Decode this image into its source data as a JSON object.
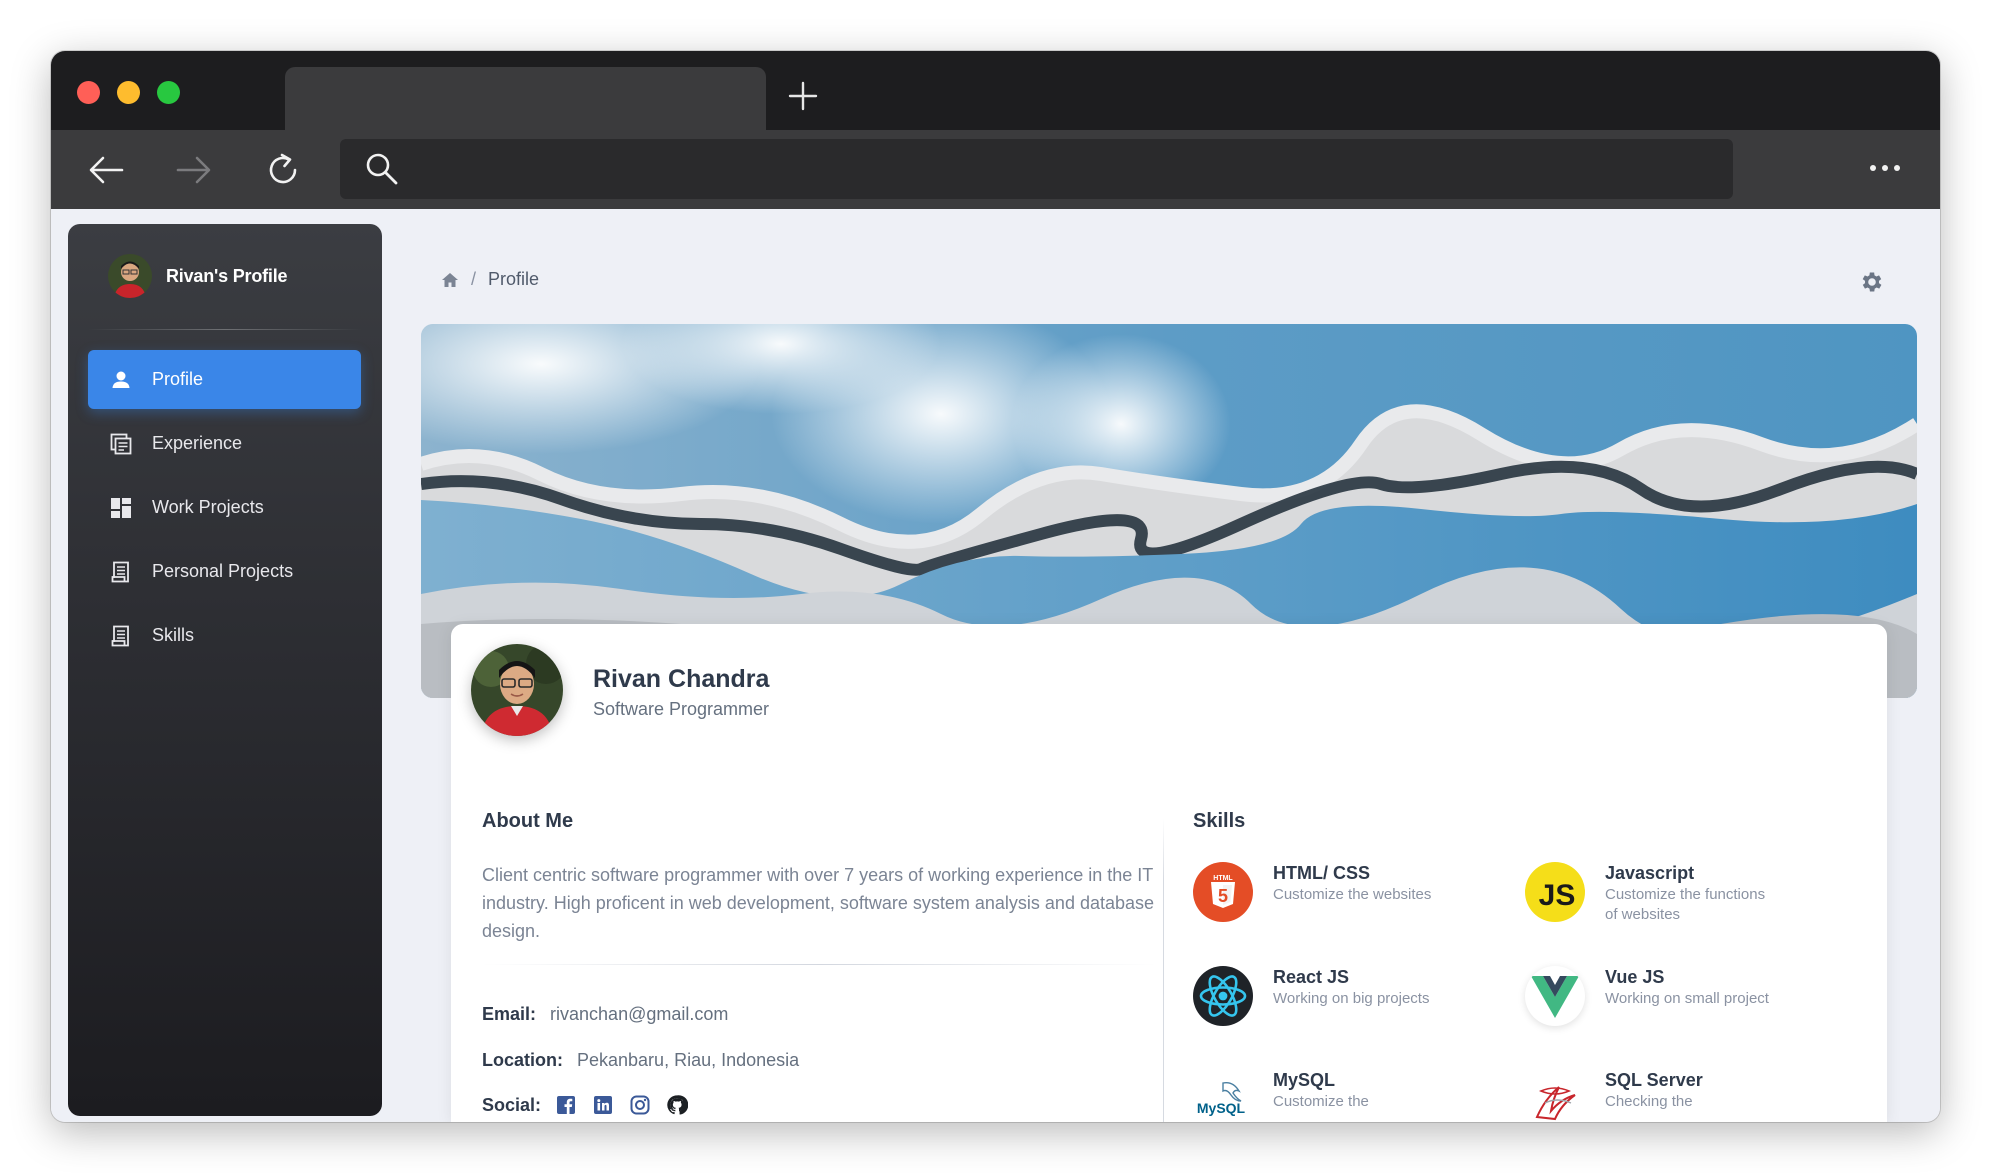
{
  "browser": {
    "address_placeholder": "",
    "colors": {
      "close": "#ff5f57",
      "minimize": "#febc2e",
      "maximize": "#28c840"
    }
  },
  "sidebar": {
    "brand_title": "Rivan's Profile",
    "items": [
      {
        "label": "Profile",
        "icon": "person-icon",
        "active": true
      },
      {
        "label": "Experience",
        "icon": "experience-icon",
        "active": false
      },
      {
        "label": "Work Projects",
        "icon": "dashboard-icon",
        "active": false
      },
      {
        "label": "Personal Projects",
        "icon": "document-icon",
        "active": false
      },
      {
        "label": "Skills",
        "icon": "document-icon",
        "active": false
      }
    ]
  },
  "breadcrumb": {
    "home_icon": "home-icon",
    "sep": "/",
    "current": "Profile"
  },
  "profile": {
    "name": "Rivan Chandra",
    "role": "Software Programmer"
  },
  "about": {
    "title": "About Me",
    "text": "Client centric software programmer with over 7 years of working experience in the IT industry. High proficent in web development, software system analysis and database design.",
    "email_label": "Email:",
    "email": "rivanchan@gmail.com",
    "location_label": "Location:",
    "location": "Pekanbaru, Riau, Indonesia",
    "social_label": "Social:",
    "social": [
      "facebook-icon",
      "linkedin-icon",
      "instagram-icon",
      "github-icon"
    ]
  },
  "skills": {
    "title": "Skills",
    "items": [
      {
        "name": "HTML/ CSS",
        "desc": "Customize the websites",
        "icon": "html5-icon"
      },
      {
        "name": "Javascript",
        "desc": "Customize the functions of websites",
        "icon": "javascript-icon"
      },
      {
        "name": "React JS",
        "desc": "Working on big projects",
        "icon": "react-icon"
      },
      {
        "name": "Vue JS",
        "desc": "Working on small project",
        "icon": "vue-icon"
      },
      {
        "name": "MySQL",
        "desc": "Customize the",
        "icon": "mysql-icon"
      },
      {
        "name": "SQL Server",
        "desc": "Checking the",
        "icon": "sql-server-icon"
      }
    ]
  },
  "colors": {
    "accent": "#3a86e8",
    "heading": "#2f3a4b",
    "muted": "#7b8494",
    "social": "#3b5998"
  }
}
